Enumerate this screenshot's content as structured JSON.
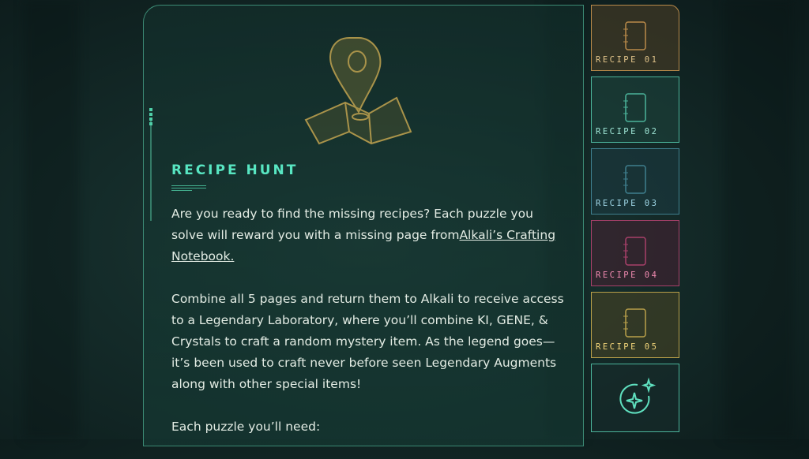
{
  "header": {
    "title": "RECIPE HUNT"
  },
  "intro": {
    "text_before_link": "Are you ready to find the missing recipes? Each puzzle you solve will reward you with a missing page from",
    "link_text": "Alkali’s Crafting Notebook."
  },
  "paragraph2": "Combine all 5 pages and return them to Alkali to receive access to a Legendary Laboratory, where you’ll combine KI, GENE, & Crystals to craft a random mystery item. As the legend goes—it’s been used to craft never before seen Legendary Augments along with other special items!",
  "paragraph3": "Each puzzle you’ll need:",
  "sidebar": {
    "recipes": [
      {
        "label": "RECIPE 01",
        "color": "#e0c38a",
        "border": "#b98a4a",
        "bg": "#3a3324"
      },
      {
        "label": "RECIPE 02",
        "color": "#9fe6d6",
        "border": "#4bb39a",
        "bg": "#1d3c38"
      },
      {
        "label": "RECIPE 03",
        "color": "#9fd6e6",
        "border": "#3f7f8e",
        "bg": "#1c3338"
      },
      {
        "label": "RECIPE 04",
        "color": "#f08ab0",
        "border": "#a8406a",
        "bg": "#3a2230"
      },
      {
        "label": "RECIPE 05",
        "color": "#f2d57a",
        "border": "#b9a04a",
        "bg": "#3b3a22"
      }
    ],
    "bonus": {
      "icon": "sparkle-icon",
      "color": "#5fe0bf"
    }
  },
  "icons": {
    "hero": "map-pin-icon",
    "recipe": "notebook-icon"
  }
}
